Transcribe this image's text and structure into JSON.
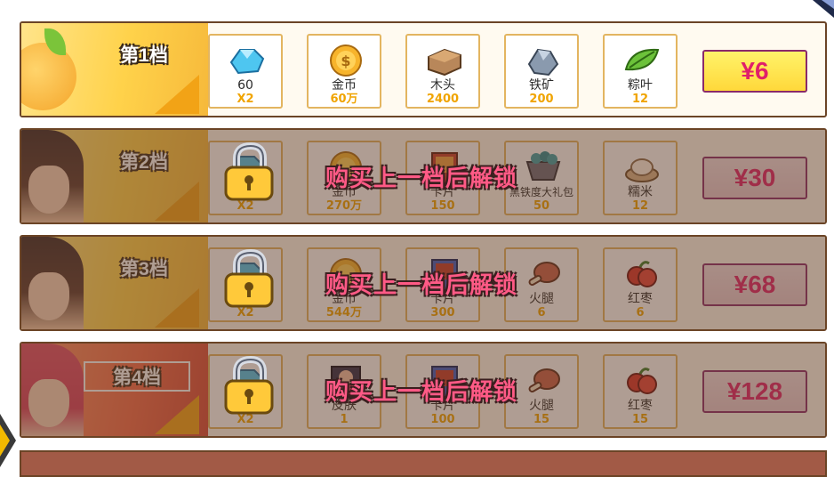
{
  "currency_symbol": "¥",
  "tiers": [
    {
      "label": "第1档",
      "price": "¥6",
      "locked": false,
      "rewards": [
        {
          "icon": "diamond-icon",
          "name": "60",
          "qty": "X2"
        },
        {
          "icon": "gold-coin-icon",
          "name": "金币",
          "qty": "60万"
        },
        {
          "icon": "wood-icon",
          "name": "木头",
          "qty": "2400"
        },
        {
          "icon": "iron-ore-icon",
          "name": "铁矿",
          "qty": "200"
        },
        {
          "icon": "zongzi-leaf-icon",
          "name": "粽叶",
          "qty": "12"
        }
      ]
    },
    {
      "label": "第2档",
      "price": "¥30",
      "locked": true,
      "lock_message": "购买上一档后解锁",
      "rewards": [
        {
          "icon": "diamond-icon",
          "name": "",
          "qty": "X2"
        },
        {
          "icon": "gold-coin-icon",
          "name": "金币",
          "qty": "270万"
        },
        {
          "icon": "card-icon",
          "name": "卡片",
          "qty": "150"
        },
        {
          "icon": "ore-cart-icon",
          "name": "黑铁度大礼包",
          "qty": "50"
        },
        {
          "icon": "glutinous-rice-icon",
          "name": "糯米",
          "qty": "12"
        }
      ]
    },
    {
      "label": "第3档",
      "price": "¥68",
      "locked": true,
      "lock_message": "购买上一档后解锁",
      "rewards": [
        {
          "icon": "diamond-icon",
          "name": "",
          "qty": "X2"
        },
        {
          "icon": "gold-coin-icon",
          "name": "金币",
          "qty": "544万"
        },
        {
          "icon": "card-icon",
          "name": "卡片",
          "qty": "300"
        },
        {
          "icon": "ham-icon",
          "name": "火腿",
          "qty": "6"
        },
        {
          "icon": "red-date-icon",
          "name": "红枣",
          "qty": "6"
        }
      ]
    },
    {
      "label": "第4档",
      "price": "¥128",
      "locked": true,
      "lock_message": "购买上一档后解锁",
      "rewards": [
        {
          "icon": "diamond-icon",
          "name": "",
          "qty": "X2"
        },
        {
          "icon": "skin-icon",
          "name": "皮肤",
          "qty": "1"
        },
        {
          "icon": "card-icon",
          "name": "卡片",
          "qty": "100"
        },
        {
          "icon": "ham-icon",
          "name": "火腿",
          "qty": "15"
        },
        {
          "icon": "red-date-icon",
          "name": "红枣",
          "qty": "15"
        }
      ]
    }
  ],
  "colors": {
    "frame": "#6b4426",
    "slot_border": "#e3b560",
    "qty": "#f0a400",
    "price_text": "#e0206a",
    "lock_text": "#ff5a86",
    "active_button": "#ffd83a"
  }
}
